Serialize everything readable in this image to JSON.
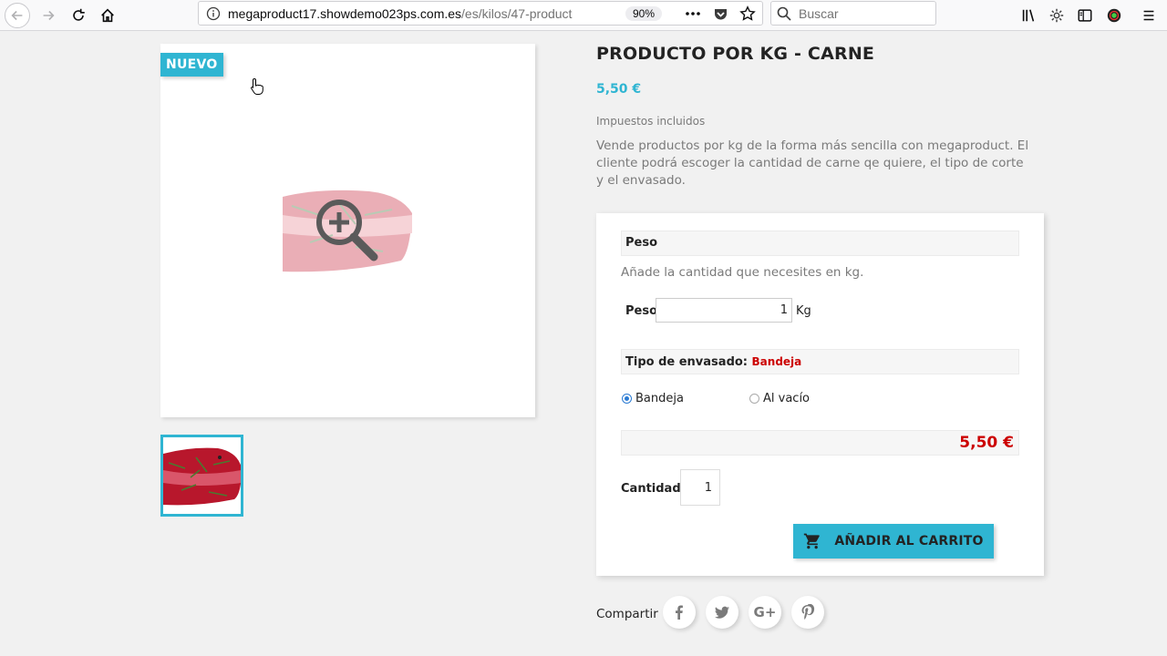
{
  "browser": {
    "url_domain": "megaproduct17.showdemo023ps.com.es",
    "url_path": "/es/kilos/47-product",
    "zoom": "90%",
    "search_placeholder": "Buscar"
  },
  "product": {
    "badge": "NUEVO",
    "title": "PRODUCTO POR KG - CARNE",
    "price": "5,50 €",
    "taxes": "Impuestos incluidos",
    "description": "Vende productos por kg de la forma más sencilla con megaproduct. El cliente podrá escoger la cantidad de carne qe quiere, el tipo de corte y el envasado."
  },
  "options": {
    "weight_heading": "Peso",
    "weight_hint": "Añade la cantidad que necesites en kg.",
    "weight_label": "Peso",
    "weight_value": "1",
    "weight_unit": "Kg",
    "packaging_heading": "Tipo de envasado:",
    "packaging_selected": "Bandeja",
    "packaging_options": [
      "Bandeja",
      "Al vacío"
    ],
    "total": "5,50 €",
    "quantity_label": "Cantidad:",
    "quantity_value": "1",
    "add_to_cart": "AÑADIR AL CARRITO"
  },
  "share": {
    "label": "Compartir",
    "google_glyph": "G+"
  },
  "colors": {
    "accent": "#2fb5d2",
    "price_red": "#cc0000"
  }
}
